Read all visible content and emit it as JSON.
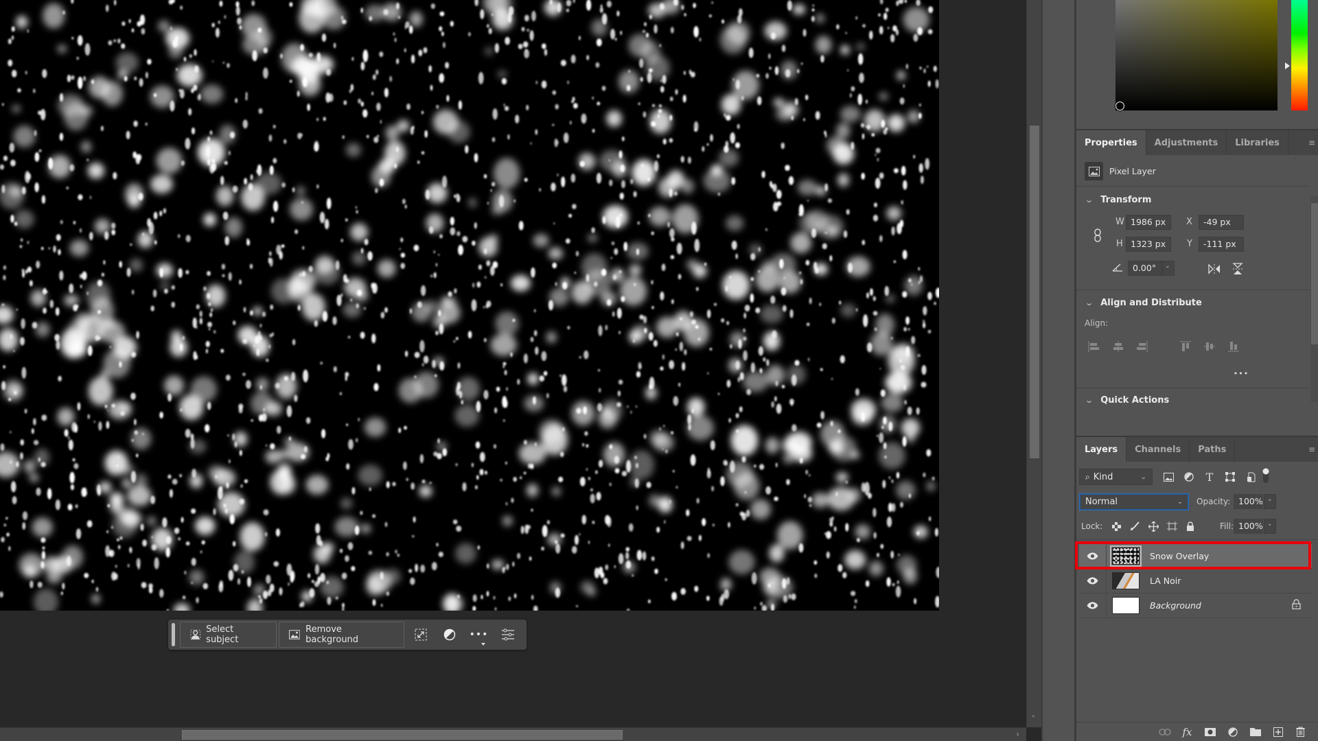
{
  "canvas": {
    "layer_content": "snow particles on black"
  },
  "task_bar": {
    "select_subject_label": "Select subject",
    "remove_background_label": "Remove background",
    "icons": [
      "transform-selection-icon",
      "adjustment-circle-icon",
      "more-options-icon",
      "task-bar-settings-icon"
    ]
  },
  "color_picker": {
    "field_hue_hex": "#7a7400",
    "selected_color_hex": "#000000"
  },
  "properties_panel": {
    "tabs": [
      {
        "label": "Properties",
        "active": true
      },
      {
        "label": "Adjustments",
        "active": false
      },
      {
        "label": "Libraries",
        "active": false
      }
    ],
    "layer_type": "Pixel Layer",
    "transform": {
      "title": "Transform",
      "w_label": "W",
      "w_value": "1986 px",
      "h_label": "H",
      "h_value": "1323 px",
      "x_label": "X",
      "x_value": "-49 px",
      "y_label": "Y",
      "y_value": "-111 px",
      "angle_value": "0.00°"
    },
    "align": {
      "title": "Align and Distribute",
      "label": "Align:",
      "more": "•••"
    },
    "quick_actions": {
      "title": "Quick Actions"
    }
  },
  "layers_panel": {
    "tabs": [
      {
        "label": "Layers",
        "active": true
      },
      {
        "label": "Channels",
        "active": false
      },
      {
        "label": "Paths",
        "active": false
      }
    ],
    "filter_kind": "Kind",
    "blend_mode": "Normal",
    "opacity_label": "Opacity:",
    "opacity_value": "100%",
    "lock_label": "Lock:",
    "fill_label": "Fill:",
    "fill_value": "100%",
    "layers": [
      {
        "name": "Snow Overlay",
        "visible": true,
        "selected": true,
        "locked": false
      },
      {
        "name": "LA Noir",
        "visible": true,
        "selected": false,
        "locked": false
      },
      {
        "name": "Background",
        "visible": true,
        "selected": false,
        "locked": true
      }
    ],
    "highlight_color": "#e8000b"
  }
}
